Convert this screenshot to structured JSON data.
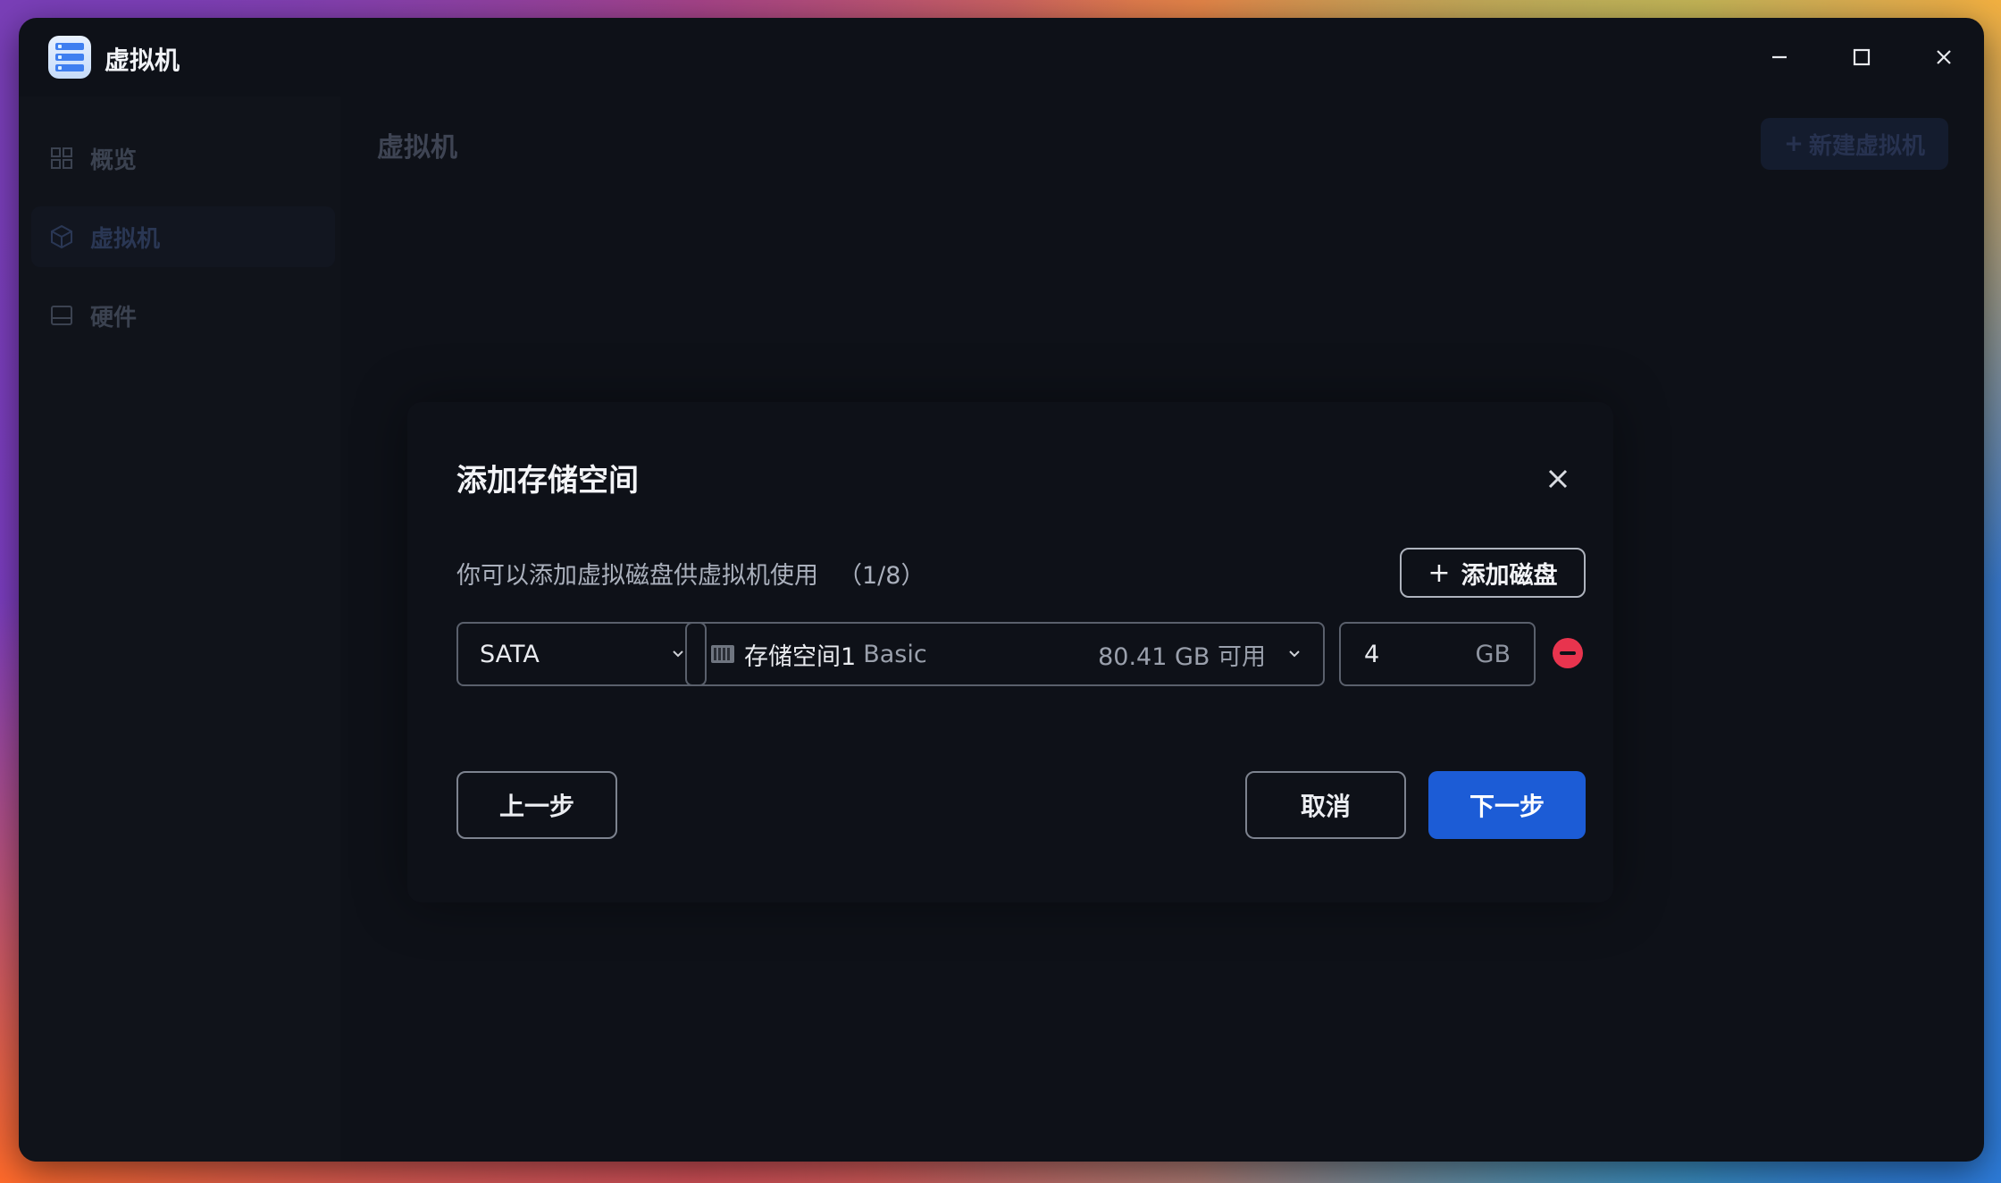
{
  "app": {
    "title": "虚拟机",
    "icon": "server-stack-icon"
  },
  "sidebar": {
    "items": [
      {
        "label": "概览",
        "icon": "grid-icon",
        "active": false
      },
      {
        "label": "虚拟机",
        "icon": "cube-icon",
        "active": true
      },
      {
        "label": "硬件",
        "icon": "drive-icon",
        "active": false
      }
    ]
  },
  "main": {
    "title": "虚拟机",
    "new_vm_label": "新建虚拟机",
    "new_vm_plus": "+"
  },
  "dialog": {
    "title": "添加存储空间",
    "description": "你可以添加虚拟磁盘供虚拟机使用",
    "count": "（1/8）",
    "add_disk_label": "添加磁盘",
    "add_disk_plus": "+",
    "disk": {
      "bus": "SATA",
      "storage_name": "存储空间1",
      "storage_type": "Basic",
      "storage_free": "80.41 GB 可用",
      "size_value": "4",
      "size_unit": "GB"
    },
    "prev_label": "上一步",
    "cancel_label": "取消",
    "next_label": "下一步"
  },
  "colors": {
    "window_bg": "#0e1118",
    "accent": "#1c5cd6",
    "danger": "#e8344e"
  }
}
